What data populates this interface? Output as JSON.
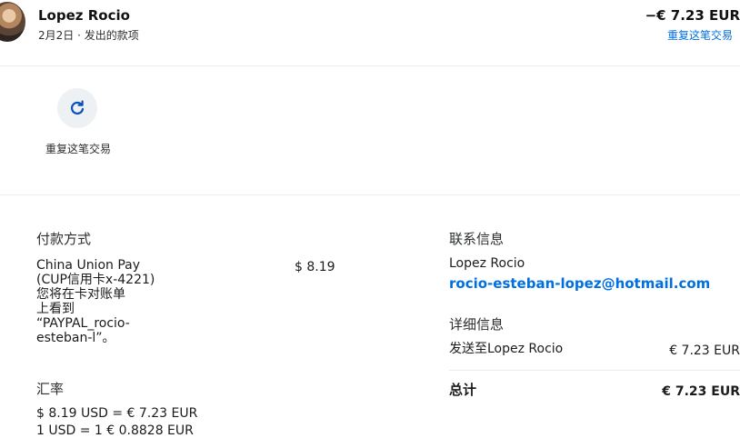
{
  "header": {
    "name": "Lopez Rocio",
    "subtitle": "2月2日 · 发出的款项",
    "amount": "−€ 7.23 EUR",
    "repeat_link": "重复这笔交易"
  },
  "action": {
    "icon": "refresh-icon",
    "label": "重复这笔交易"
  },
  "payment": {
    "title": "付款方式",
    "method_lines": [
      "China Union Pay",
      "(CUP信用卡x-4221)",
      "您将在卡对账单",
      "上看到",
      "“PAYPAL_rocio-",
      "esteban-l”。"
    ],
    "amount": "$ 8.19"
  },
  "exchange": {
    "title": "汇率",
    "line1": "$ 8.19 USD = € 7.23 EUR",
    "line2": "1 USD = 1 € 0.8828 EUR"
  },
  "contact": {
    "title": "联系信息",
    "name": "Lopez Rocio",
    "email": "rocio-esteban-lopez@hotmail.com"
  },
  "details": {
    "title": "详细信息",
    "sent_label": "发送至Lopez Rocio",
    "sent_amount": "€ 7.23 EUR",
    "total_label": "总计",
    "total_amount": "€ 7.23 EUR"
  },
  "colors": {
    "link": "#0070e0",
    "divider": "#ececec",
    "icon": "#0a4fbd"
  }
}
